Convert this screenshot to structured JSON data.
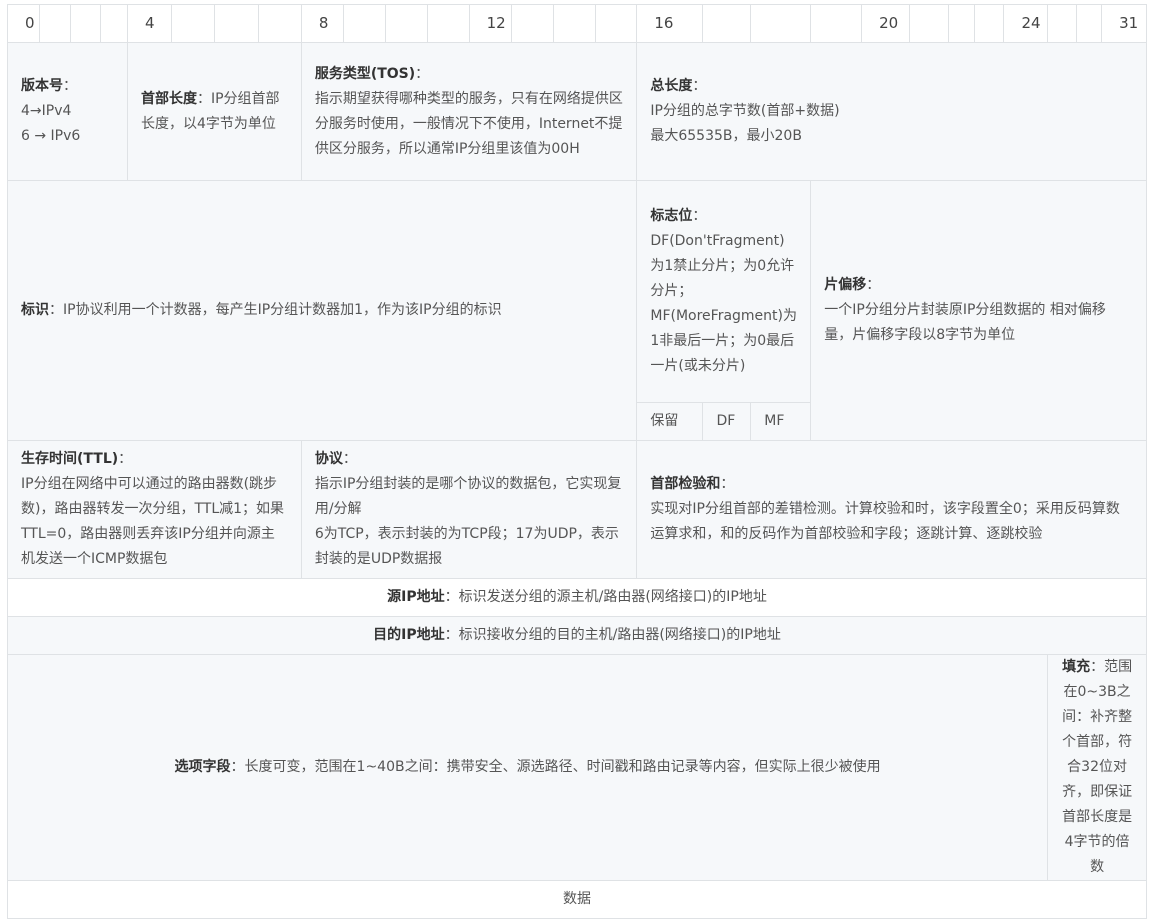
{
  "bits": [
    "0",
    "",
    "",
    "",
    "4",
    "",
    "",
    "",
    "8",
    "",
    "",
    "",
    "12",
    "",
    "",
    "",
    "16",
    "",
    "",
    "",
    "20",
    "",
    "",
    "",
    "24",
    "",
    "",
    "31"
  ],
  "version": {
    "label": "版本号",
    "sep": "：",
    "lines": [
      "4→IPv4",
      "6 → IPv6"
    ]
  },
  "ihl": {
    "label": "首部长度",
    "sep": "：",
    "text": "IP分组首部长度，以4字节为单位"
  },
  "tos": {
    "label": "服务类型(TOS)",
    "sep": "：",
    "text": "指示期望获得哪种类型的服务，只有在网络提供区分服务时使用，一般情况下不使用，Internet不提供区分服务，所以通常IP分组里该值为00H"
  },
  "total_length": {
    "label": "总长度",
    "sep": "：",
    "lines": [
      "IP分组的总字节数(首部+数据)",
      "最大65535B，最小20B"
    ]
  },
  "identification": {
    "label": "标识",
    "sep": "：",
    "text": "IP协议利用一个计数器，每产生IP分组计数器加1，作为该IP分组的标识"
  },
  "flags": {
    "label": "标志位",
    "sep": "：",
    "lines": [
      "DF(Don'tFragment)为1禁止分片；为0允许分片；",
      "MF(MoreFragment)为1非最后一片；为0最后一片(或未分片)"
    ],
    "bits": [
      "保留",
      "DF",
      "MF"
    ]
  },
  "fragment_offset": {
    "label": "片偏移",
    "sep": "：",
    "text": "一个IP分组分片封装原IP分组数据的 相对偏移量，片偏移字段以8字节为单位"
  },
  "ttl": {
    "label": "生存时间(TTL)",
    "sep": "：",
    "text": "IP分组在网络中可以通过的路由器数(跳步数)，路由器转发一次分组，TTL减1；如果TTL=0，路由器则丢弃该IP分组并向源主机发送一个ICMP数据包"
  },
  "protocol": {
    "label": "协议",
    "sep": "：",
    "lines": [
      "指示IP分组封装的是哪个协议的数据包，它实现复用/分解",
      "6为TCP，表示封装的为TCP段；17为UDP，表示封装的是UDP数据报"
    ]
  },
  "checksum": {
    "label": "首部检验和",
    "sep": "：",
    "text": "实现对IP分组首部的差错检测。计算校验和时，该字段置全0；采用反码算数运算求和，和的反码作为首部校验和字段；逐跳计算、逐跳校验"
  },
  "src_ip": {
    "label": "源IP地址",
    "sep": "：",
    "text": "标识发送分组的源主机/路由器(网络接口)的IP地址"
  },
  "dst_ip": {
    "label": "目的IP地址",
    "sep": "：",
    "text": "标识接收分组的目的主机/路由器(网络接口)的IP地址"
  },
  "options": {
    "label": "选项字段",
    "sep": "：",
    "text": "长度可变，范围在1~40B之间：携带安全、源选路径、时间戳和路由记录等内容，但实际上很少被使用"
  },
  "padding": {
    "label": "填充",
    "sep": "：",
    "text": "范围在0~3B之间：补齐整个首部，符合32位对齐，即保证首部长度是4字节的倍数"
  },
  "data": {
    "text": "数据"
  }
}
